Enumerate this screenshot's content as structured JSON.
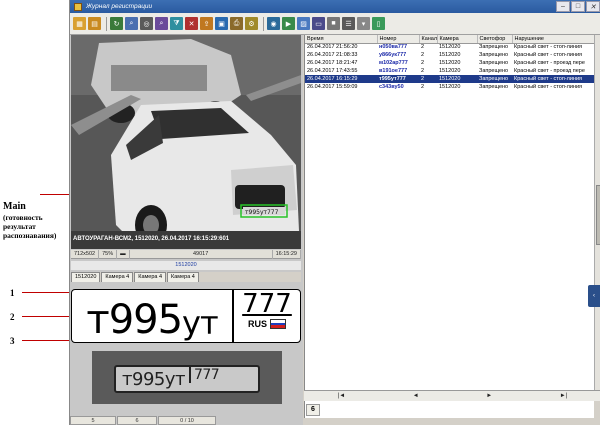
{
  "annotations": {
    "main_title": "Main",
    "main_sub": "(готовность результат распознавания)",
    "n1": "1",
    "n2": "2",
    "n3": "3"
  },
  "window": {
    "title": "Журнал регистрации",
    "controls": [
      "–",
      "□",
      "✕"
    ]
  },
  "camera": {
    "caption": "АВТОУРАГАН-ВСМ2, 1512020, 26.04.2017 16:15:29:601",
    "status": [
      "712x502",
      "75%",
      "▬",
      "49017",
      "16:15:29"
    ],
    "label": "1512020",
    "tabs": [
      "1512020",
      "Камера 4",
      "Камера 4",
      "Камера 4"
    ]
  },
  "plate": {
    "letter1": "т",
    "digits": "995",
    "letters2": "ут",
    "region": "777",
    "country": "RUS",
    "flag_colors": [
      "#ffffff",
      "#1c3fbf",
      "#d21f1f"
    ]
  },
  "crop_plate": {
    "text": "т995ут",
    "region": "777"
  },
  "left_status": [
    "5",
    "6",
    "0 / 10"
  ],
  "log": {
    "columns": [
      "Время",
      "Номер",
      "Канал",
      "Камера",
      "Светофор",
      "Нарушение"
    ],
    "rows": [
      [
        "26.04.2017 21:56:20",
        "н050ва777",
        "2",
        "1512020",
        "Запрещено",
        "Красный свет - стоп-линия"
      ],
      [
        "26.04.2017 21:08:33",
        "у866ук777",
        "2",
        "1512020",
        "Запрещено",
        "Красный свет - стоп-линия"
      ],
      [
        "26.04.2017 18:21:47",
        "м102ар777",
        "2",
        "1512020",
        "Запрещено",
        "Красный свет - проезд пере"
      ],
      [
        "26.04.2017 17:43:55",
        "в191ое777",
        "2",
        "1512020",
        "Запрещено",
        "Красный свет - проезд пере"
      ],
      [
        "26.04.2017 16:15:29",
        "т995ут777",
        "2",
        "1512020",
        "Запрещено",
        "Красный свет - стоп-линия"
      ],
      [
        "26.04.2017 15:59:09",
        "с343ву50",
        "2",
        "1512020",
        "Запрещено",
        "Красный свет - стоп-линия"
      ]
    ],
    "selected_index": 4
  },
  "nav": [
    "|◄",
    "◄",
    "►",
    "►|"
  ],
  "page_number": "6",
  "side_tab": "‹",
  "colors": {
    "title_bar": "#2a5aa0",
    "selection": "#1e3a8a",
    "plate_number_text": "#1a28a8",
    "annotation_line": "#c00000"
  }
}
